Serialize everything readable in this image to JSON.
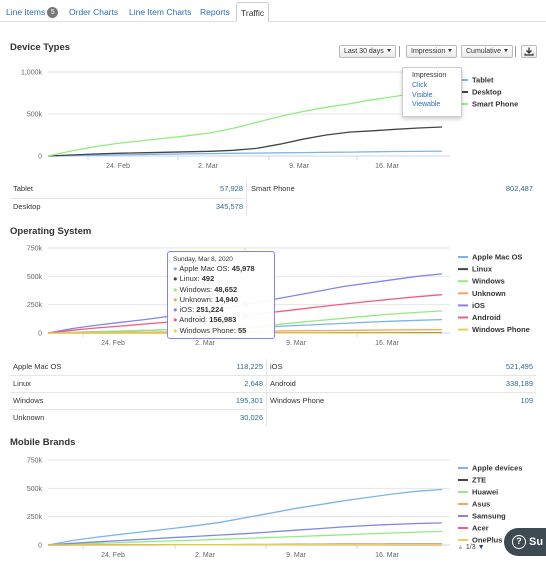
{
  "tabs": [
    {
      "label": "Line Items",
      "badge": "5"
    },
    {
      "label": "Order Charts"
    },
    {
      "label": "Line Item Charts"
    },
    {
      "label": "Reports"
    },
    {
      "label": "Traffic",
      "active": true
    }
  ],
  "toolbar": {
    "range": "Last 30 days",
    "metric": "Impression",
    "mode": "Cumulative",
    "download_icon": "download-icon"
  },
  "metric_menu": {
    "header": "Impression",
    "items": [
      "Click",
      "Visible",
      "Viewable"
    ]
  },
  "sections": {
    "device_title": "Device Types",
    "os_title": "Operating System",
    "brands_title": "Mobile Brands"
  },
  "device_stats": {
    "tablet_label": "Tablet",
    "tablet_value": "57,928",
    "smartphone_label": "Smart Phone",
    "smartphone_value": "802,487",
    "desktop_label": "Desktop",
    "desktop_value": "345,578"
  },
  "os_stats": {
    "apple_label": "Apple Mac OS",
    "apple_value": "118,225",
    "ios_label": "iOS",
    "ios_value": "521,495",
    "linux_label": "Linux",
    "linux_value": "2,648",
    "android_label": "Android",
    "android_value": "338,189",
    "windows_label": "Windows",
    "windows_value": "195,301",
    "winphone_label": "Windows Phone",
    "winphone_value": "109",
    "unknown_label": "Unknown",
    "unknown_value": "30,026"
  },
  "tooltip": {
    "date": "Sunday, Mar 8, 2020",
    "rows": [
      {
        "label": "Apple Mac OS:",
        "value": "45,978",
        "color": "#7cb5ec"
      },
      {
        "label": "Linux:",
        "value": "492",
        "color": "#434348"
      },
      {
        "label": "Windows:",
        "value": "48,652",
        "color": "#90ed7d"
      },
      {
        "label": "Unknown:",
        "value": "14,940",
        "color": "#f7a35c"
      },
      {
        "label": "iOS:",
        "value": "251,224",
        "color": "#8085e9"
      },
      {
        "label": "Android:",
        "value": "156,983",
        "color": "#f15c80"
      },
      {
        "label": "Windows Phone:",
        "value": "55",
        "color": "#e4d354"
      }
    ]
  },
  "pager": {
    "text": "1/3"
  },
  "help_label": "Su",
  "chart_data": [
    {
      "type": "line",
      "title": "Device Types",
      "x_ticks": [
        "24. Feb",
        "2. Mar",
        "9. Mar",
        "16. Mar"
      ],
      "y_ticks": [
        "0",
        "500k",
        "1,000k"
      ],
      "ylim": [
        0,
        1000000
      ],
      "legend_position": "right",
      "series": [
        {
          "name": "Tablet",
          "color": "#7cb5ec",
          "values": [
            0,
            5000,
            9000,
            13000,
            17000,
            21000,
            25000,
            29000,
            32000,
            35000,
            38000,
            41000,
            44000,
            47000,
            50000,
            53000,
            55000,
            57928
          ]
        },
        {
          "name": "Desktop",
          "color": "#434348",
          "values": [
            0,
            12000,
            24000,
            32000,
            38000,
            44000,
            50000,
            56000,
            68000,
            90000,
            140000,
            200000,
            250000,
            285000,
            300000,
            318000,
            333000,
            345578
          ]
        },
        {
          "name": "Smart Phone",
          "color": "#90ed7d",
          "values": [
            0,
            60000,
            110000,
            150000,
            180000,
            210000,
            240000,
            275000,
            330000,
            400000,
            470000,
            530000,
            580000,
            620000,
            670000,
            710000,
            760000,
            802487
          ]
        }
      ]
    },
    {
      "type": "line",
      "title": "Operating System",
      "x_ticks": [
        "24. Feb",
        "2. Mar",
        "9. Mar",
        "16. Mar"
      ],
      "y_ticks": [
        "0",
        "250k",
        "500k",
        "750k"
      ],
      "ylim": [
        0,
        750000
      ],
      "legend_position": "right",
      "series": [
        {
          "name": "Apple Mac OS",
          "color": "#7cb5ec",
          "values": [
            0,
            6000,
            12000,
            18000,
            24000,
            30000,
            36000,
            42000,
            45978,
            55000,
            65000,
            75000,
            85000,
            95000,
            104000,
            112000,
            118225
          ]
        },
        {
          "name": "Linux",
          "color": "#434348",
          "values": [
            0,
            60,
            120,
            180,
            240,
            320,
            400,
            460,
            492,
            700,
            1000,
            1300,
            1600,
            1900,
            2200,
            2450,
            2648
          ]
        },
        {
          "name": "Windows",
          "color": "#90ed7d",
          "values": [
            0,
            6000,
            12000,
            18000,
            24000,
            30000,
            36000,
            42000,
            48652,
            68000,
            90000,
            110000,
            130000,
            150000,
            168000,
            182000,
            195301
          ]
        },
        {
          "name": "Unknown",
          "color": "#f7a35c",
          "values": [
            0,
            2000,
            4000,
            6000,
            8000,
            10000,
            12000,
            13500,
            14940,
            17000,
            19000,
            21000,
            23000,
            25000,
            27000,
            28500,
            30026
          ]
        },
        {
          "name": "iOS",
          "color": "#8085e9",
          "values": [
            0,
            40000,
            70000,
            95000,
            120000,
            150000,
            180000,
            215000,
            251224,
            290000,
            330000,
            370000,
            410000,
            440000,
            470000,
            500000,
            521495
          ]
        },
        {
          "name": "Android",
          "color": "#f15c80",
          "values": [
            0,
            25000,
            45000,
            62000,
            80000,
            98000,
            118000,
            138000,
            156983,
            180000,
            205000,
            230000,
            255000,
            278000,
            300000,
            320000,
            338189
          ]
        },
        {
          "name": "Windows Phone",
          "color": "#e4d354",
          "values": [
            0,
            5,
            10,
            15,
            20,
            30,
            40,
            48,
            55,
            62,
            70,
            77,
            84,
            91,
            98,
            104,
            109
          ]
        }
      ]
    },
    {
      "type": "line",
      "title": "Mobile Brands",
      "x_ticks": [
        "24. Feb",
        "2. Mar",
        "9. Mar",
        "16. Mar"
      ],
      "y_ticks": [
        "0",
        "250k",
        "500k",
        "750k"
      ],
      "ylim": [
        0,
        750000
      ],
      "legend_position": "right",
      "legend_page": "1/3",
      "series": [
        {
          "name": "Apple devices",
          "color": "#7cb5ec",
          "values": [
            0,
            40000,
            70000,
            95000,
            120000,
            145000,
            170000,
            200000,
            240000,
            280000,
            320000,
            355000,
            390000,
            420000,
            450000,
            475000,
            490000
          ]
        },
        {
          "name": "ZTE",
          "color": "#434348",
          "values": [
            0,
            500,
            1000,
            1500,
            2000,
            2500,
            3000,
            3500,
            4000,
            4500,
            5000,
            5500,
            6000,
            6500,
            7000,
            7500,
            8000
          ]
        },
        {
          "name": "Huawei",
          "color": "#90ed7d",
          "values": [
            0,
            8000,
            15000,
            22000,
            29000,
            36000,
            43000,
            50000,
            58000,
            66000,
            74000,
            82000,
            90000,
            98000,
            106000,
            114000,
            120000
          ]
        },
        {
          "name": "Asus",
          "color": "#f7a35c",
          "values": [
            0,
            200,
            400,
            600,
            800,
            1000,
            1200,
            1400,
            1600,
            1800,
            2000,
            2200,
            2400,
            2600,
            2800,
            3000,
            3200
          ]
        },
        {
          "name": "Samsung",
          "color": "#8085e9",
          "values": [
            0,
            15000,
            28000,
            40000,
            52000,
            64000,
            76000,
            88000,
            100000,
            115000,
            130000,
            145000,
            160000,
            172000,
            182000,
            190000,
            195000
          ]
        },
        {
          "name": "Acer",
          "color": "#f15c80",
          "values": [
            0,
            100,
            200,
            300,
            400,
            500,
            600,
            700,
            800,
            900,
            1000,
            1100,
            1200,
            1300,
            1400,
            1500,
            1600
          ]
        },
        {
          "name": "OnePlus",
          "color": "#e4d354",
          "values": [
            0,
            300,
            600,
            900,
            1200,
            1500,
            1800,
            2100,
            2400,
            2700,
            3000,
            3300,
            3600,
            3900,
            4200,
            4500,
            4800
          ]
        }
      ]
    }
  ]
}
